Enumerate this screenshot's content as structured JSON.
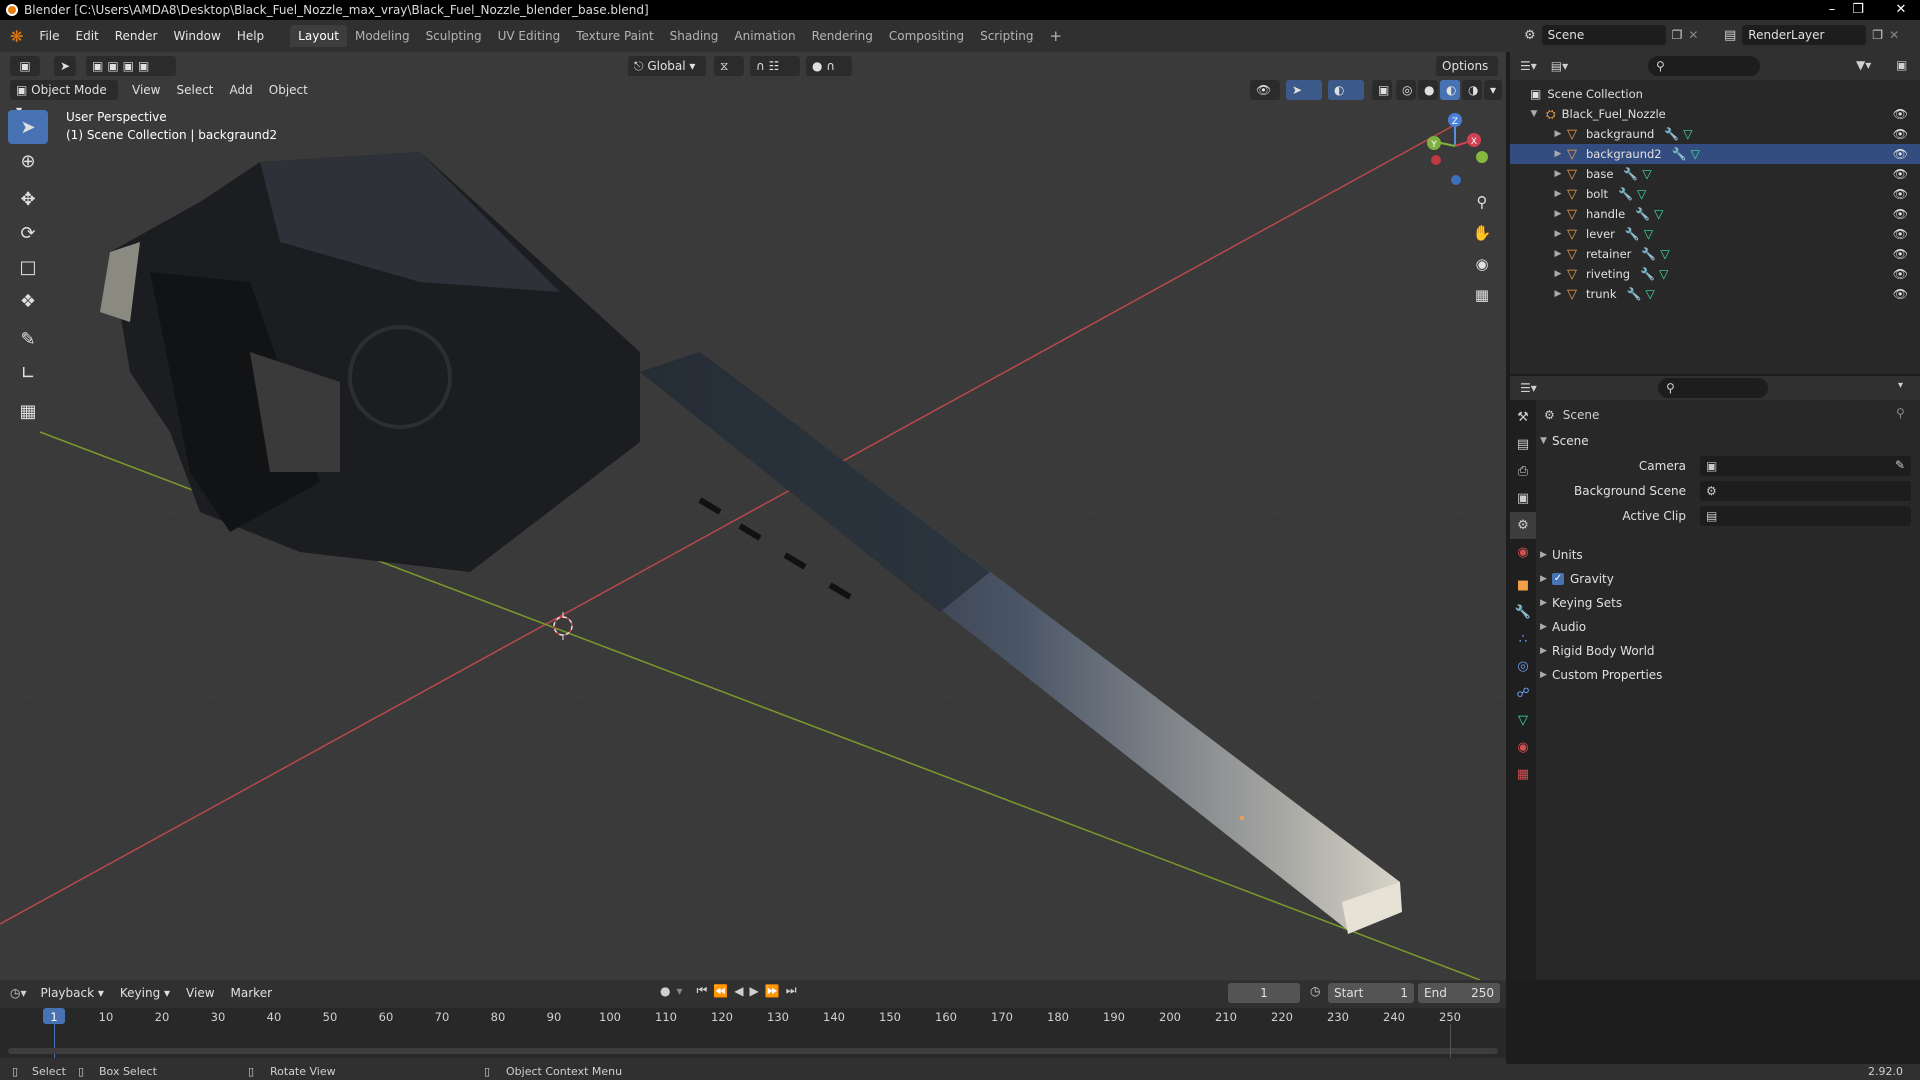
{
  "window": {
    "title": "Blender [C:\\Users\\AMDA8\\Desktop\\Black_Fuel_Nozzle_max_vray\\Black_Fuel_Nozzle_blender_base.blend]"
  },
  "menus": [
    "File",
    "Edit",
    "Render",
    "Window",
    "Help"
  ],
  "workspaces": [
    "Layout",
    "Modeling",
    "Sculpting",
    "UV Editing",
    "Texture Paint",
    "Shading",
    "Animation",
    "Rendering",
    "Compositing",
    "Scripting"
  ],
  "active_workspace": "Layout",
  "topbar": {
    "scene": "Scene",
    "view_layer": "RenderLayer"
  },
  "viewport": {
    "orientation": "Global",
    "options_label": "Options",
    "mode": "Object Mode",
    "menus": [
      "View",
      "Select",
      "Add",
      "Object"
    ],
    "info_line1": "User Perspective",
    "info_line2": "(1) Scene Collection | backgraund2",
    "gizmo": {
      "x": "X",
      "y": "Y",
      "z": "Z"
    }
  },
  "outliner": {
    "root": "Scene Collection",
    "collection": "Black_Fuel_Nozzle",
    "objects": [
      "backgraund",
      "backgraund2",
      "base",
      "bolt",
      "handle",
      "lever",
      "retainer",
      "riveting",
      "trunk"
    ]
  },
  "properties": {
    "context": "Scene",
    "panel": "Scene",
    "fields": [
      {
        "label": "Camera",
        "value": ""
      },
      {
        "label": "Background Scene",
        "value": ""
      },
      {
        "label": "Active Clip",
        "value": ""
      }
    ],
    "subpanels": [
      "Units",
      "Gravity",
      "Keying Sets",
      "Audio",
      "Rigid Body World",
      "Custom Properties"
    ],
    "gravity_checked": true
  },
  "timeline": {
    "menus": [
      "Playback",
      "Keying",
      "View",
      "Marker"
    ],
    "current_frame": "1",
    "start_label": "Start",
    "start": "1",
    "end_label": "End",
    "end": "250",
    "ticks": [
      "1",
      "10",
      "20",
      "30",
      "40",
      "50",
      "60",
      "70",
      "80",
      "90",
      "100",
      "110",
      "120",
      "130",
      "140",
      "150",
      "160",
      "170",
      "180",
      "190",
      "200",
      "210",
      "220",
      "230",
      "240",
      "250"
    ]
  },
  "statusbar": {
    "select": "Select",
    "box_select": "Box Select",
    "rotate": "Rotate View",
    "context_menu": "Object Context Menu",
    "version": "2.92.0"
  }
}
